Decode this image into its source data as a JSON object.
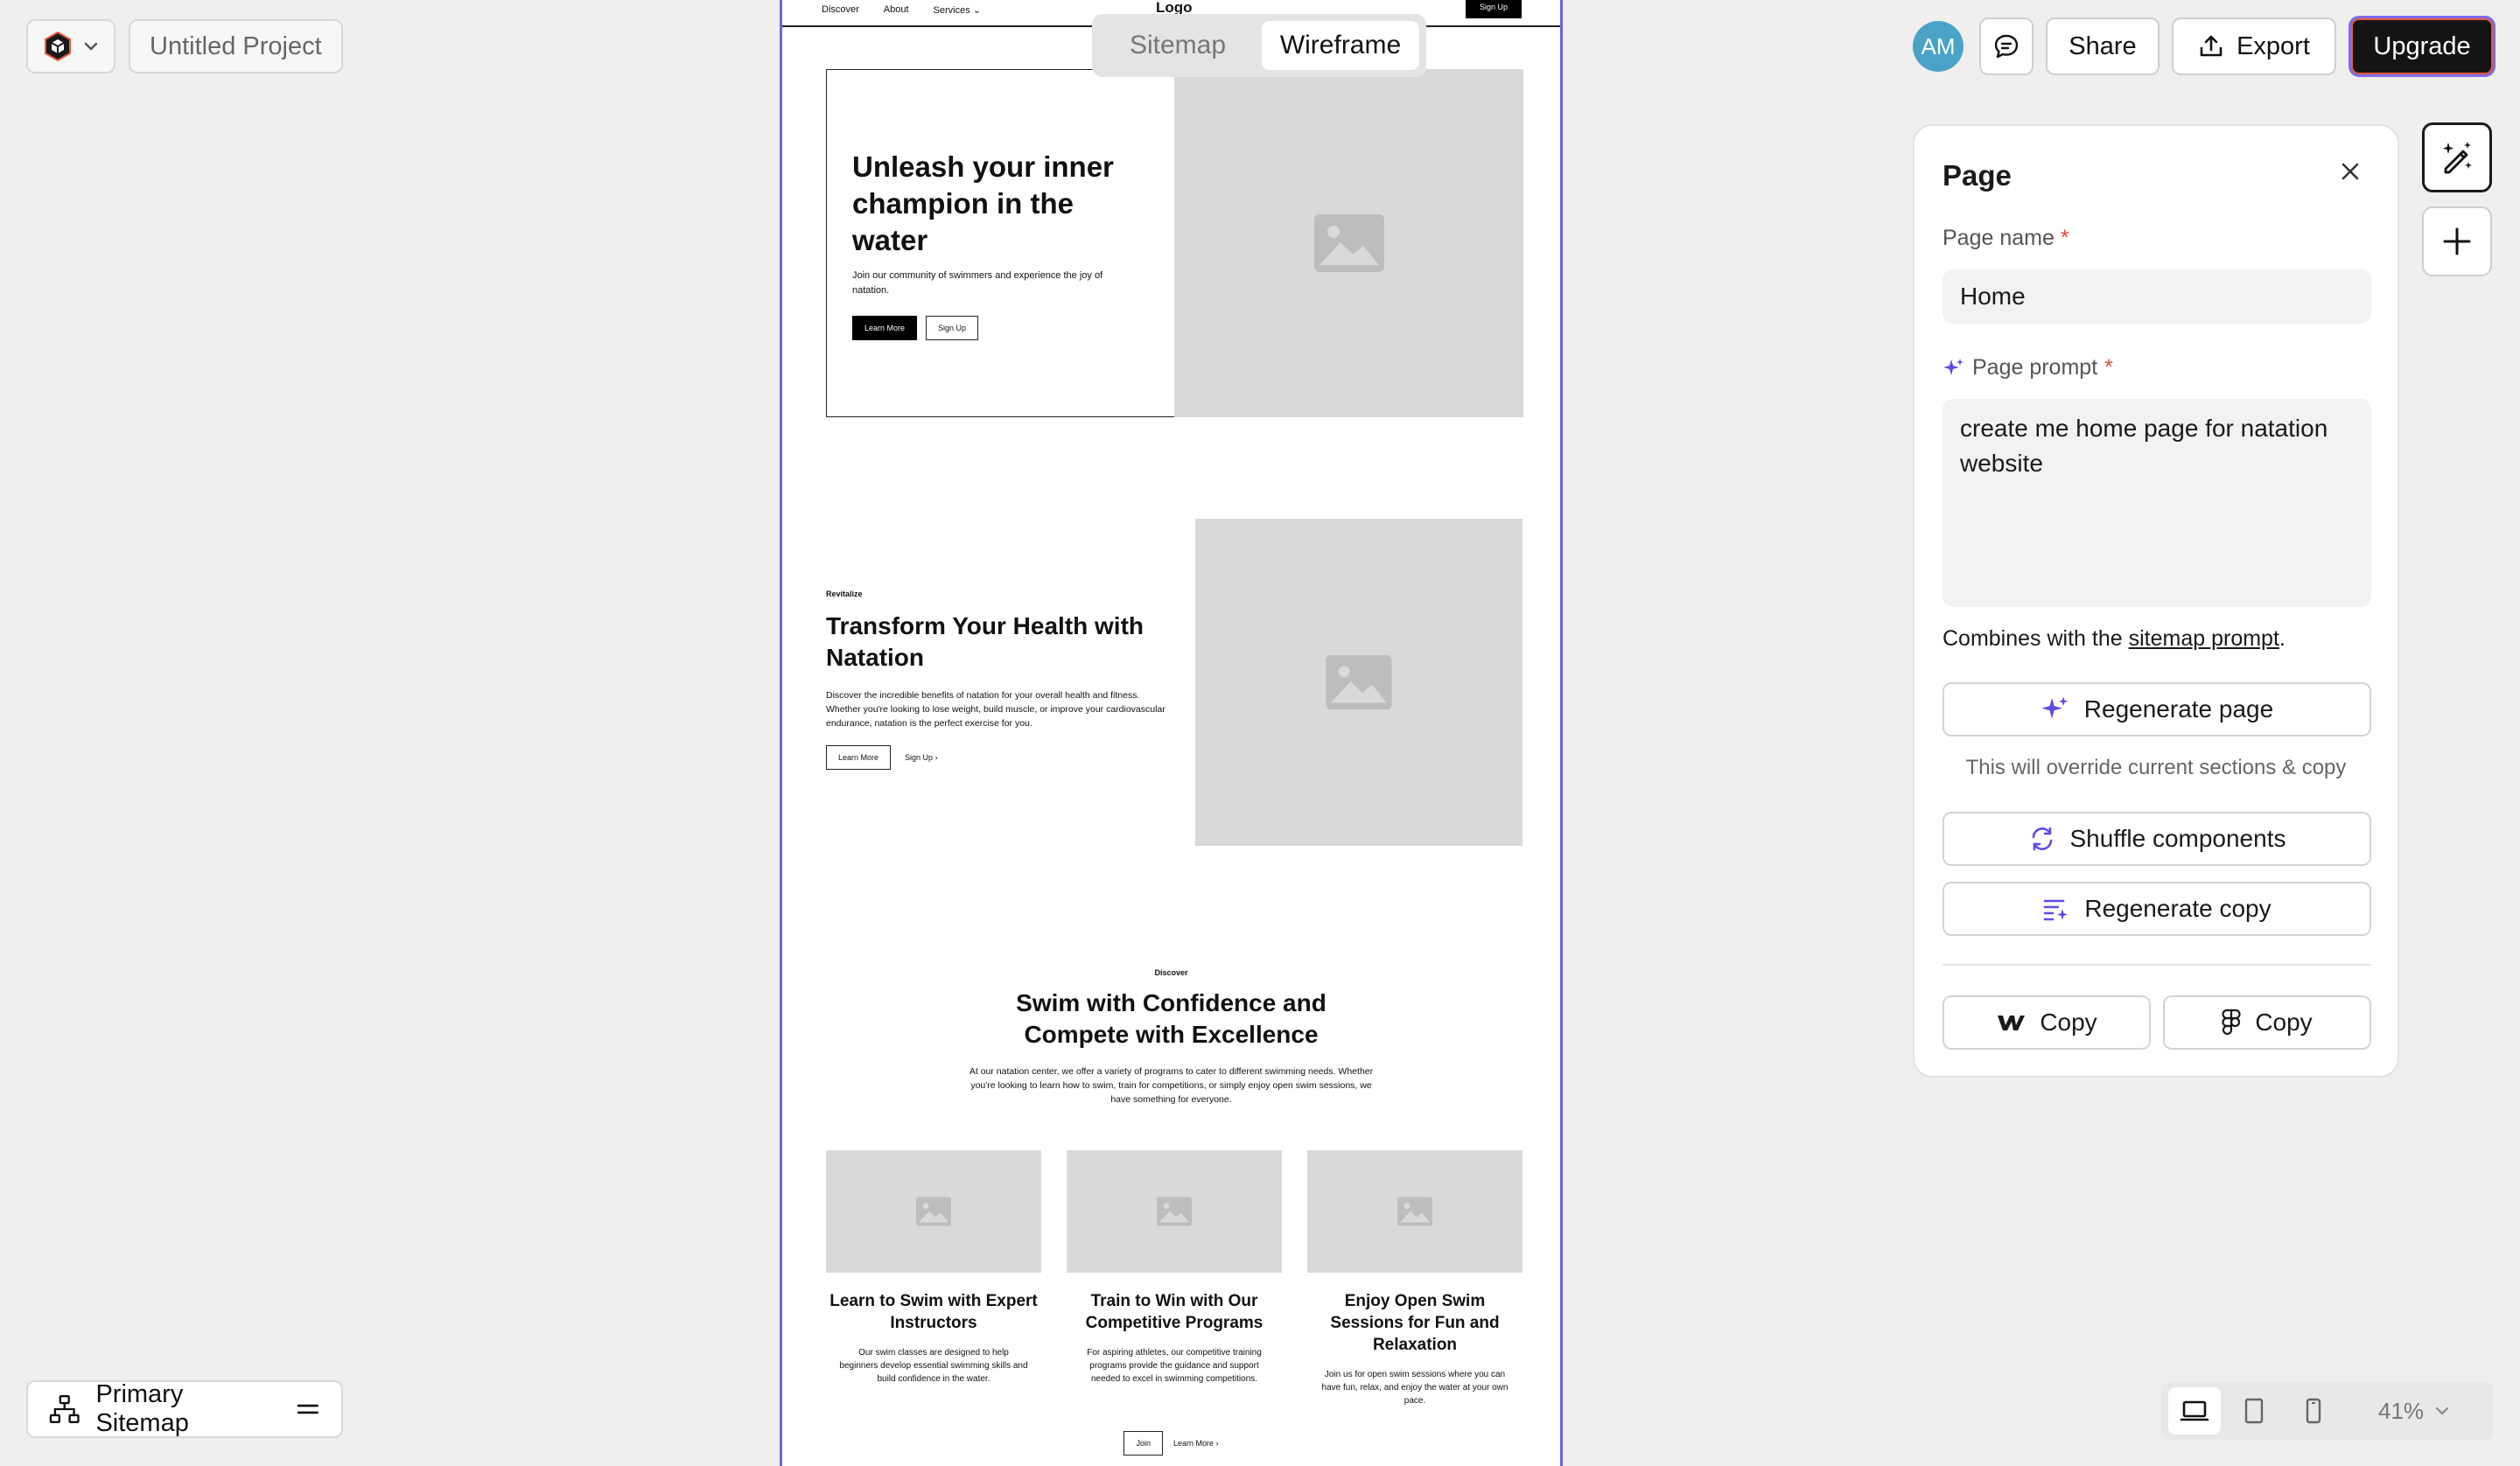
{
  "topbar": {
    "project_title": "Untitled Project",
    "view_options": {
      "sitemap": "Sitemap",
      "wireframe": "Wireframe",
      "active": "Wireframe"
    },
    "avatar_initials": "AM",
    "share_label": "Share",
    "export_label": "Export",
    "upgrade_label": "Upgrade"
  },
  "wireframe": {
    "nav": {
      "links": [
        "Discover",
        "About",
        "Services"
      ],
      "logo": "Logo",
      "signup": "Sign Up"
    },
    "hero": {
      "heading": "Unleash your inner champion in the water",
      "body": "Join our community of swimmers and experience the joy of natation.",
      "primary_btn": "Learn More",
      "secondary_btn": "Sign Up"
    },
    "feature": {
      "tagline": "Revitalize",
      "heading": "Transform Your Health with Natation",
      "body": "Discover the incredible benefits of natation for your overall health and fitness. Whether you're looking to lose weight, build muscle, or improve your cardiovascular endurance, natation is the perfect exercise for you.",
      "primary_btn": "Learn More",
      "link_btn": "Sign Up"
    },
    "discover": {
      "tagline": "Discover",
      "heading": "Swim with Confidence and Compete with Excellence",
      "body": "At our natation center, we offer a variety of programs to cater to different swimming needs. Whether you're looking to learn how to swim, train for competitions, or simply enjoy open swim sessions, we have something for everyone.",
      "cards": [
        {
          "title": "Learn to Swim with Expert Instructors",
          "body": "Our swim classes are designed to help beginners develop essential swimming skills and build confidence in the water."
        },
        {
          "title": "Train to Win with Our Competitive Programs",
          "body": "For aspiring athletes, our competitive training programs provide the guidance and support needed to excel in swimming competitions."
        },
        {
          "title": "Enjoy Open Swim Sessions for Fun and Relaxation",
          "body": "Join us for open swim sessions where you can have fun, relax, and enjoy the water at your own pace."
        }
      ],
      "primary_btn": "Join",
      "link_btn": "Learn More"
    }
  },
  "panel": {
    "title": "Page",
    "page_name_label": "Page name",
    "page_name_value": "Home",
    "page_prompt_label": "Page prompt",
    "required_mark": "*",
    "page_prompt_value": "create me home page for natation website",
    "combines_prefix": "Combines with the ",
    "combines_link": "sitemap prompt",
    "combines_suffix": ".",
    "regenerate_page_label": "Regenerate page",
    "override_note": "This will override current sections & copy",
    "shuffle_label": "Shuffle components",
    "regenerate_copy_label": "Regenerate copy",
    "copy_webflow_label": "Copy",
    "copy_figma_label": "Copy"
  },
  "bottombar": {
    "sitemap_label": "Primary Sitemap",
    "zoom": "41%"
  },
  "colors": {
    "accent": "#6c63e6",
    "upgrade_bg": "#141414",
    "avatar_bg": "#4aa3c7",
    "required": "#e04b3a"
  },
  "icons": [
    "app-logo-icon",
    "chevron-down-icon",
    "comment-icon",
    "export-icon",
    "close-icon",
    "sparkle-icon",
    "shuffle-icon",
    "regenerate-copy-icon",
    "webflow-icon",
    "figma-icon",
    "ai-edit-icon",
    "plus-icon",
    "sitemap-icon",
    "menu-icon",
    "desktop-icon",
    "tablet-icon",
    "mobile-icon",
    "image-placeholder-icon"
  ]
}
